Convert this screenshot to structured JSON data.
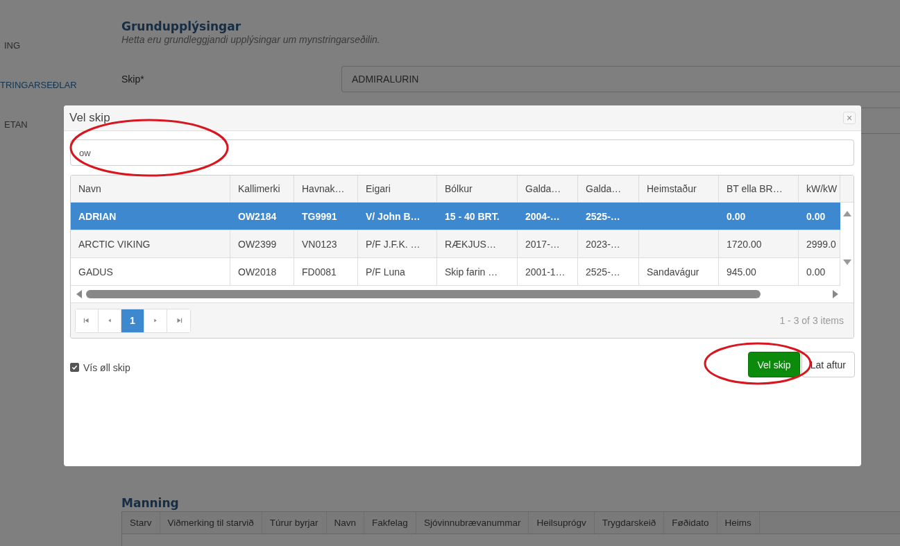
{
  "sidebar": {
    "items": [
      {
        "label": "ING",
        "selected": false
      },
      {
        "label": "TRINGARSEÐLAR",
        "selected": true
      },
      {
        "label": "ETAN",
        "selected": false
      }
    ]
  },
  "section": {
    "title": "Grundupplýsingar",
    "subtitle": "Hetta eru grundleggjandi upplýsingar um mynstringarseðilin.",
    "fields": [
      {
        "label": "Skip*",
        "value": "ADMIRALURIN"
      }
    ]
  },
  "manning": {
    "title": "Manning",
    "columns": [
      "Starv",
      "Viðmerking til starvið",
      "Túrur byrjar",
      "Navn",
      "Fakfelag",
      "Sjóvinnubrævanummar",
      "Heilsuprógv",
      "Trygdarskeið",
      "Føðidato",
      "Heims"
    ]
  },
  "dialog": {
    "title": "Vel skip",
    "close": "×",
    "search": {
      "value": "ow"
    },
    "table": {
      "columns": [
        "Navn",
        "Kallimerki",
        "Havnak…",
        "Eigari",
        "Bólkur",
        "Galda…",
        "Galda…",
        "Heimstaður",
        "BT ella BR…",
        "kW/kW"
      ],
      "rows": [
        {
          "selected": true,
          "cells": [
            "ADRIAN",
            "OW2184",
            "TG9991",
            "V/ John B…",
            "15 - 40 BRT.",
            "2004-…",
            "2525-…",
            "",
            "0.00",
            "0.00"
          ]
        },
        {
          "selected": false,
          "cells": [
            "ARCTIC VIKING",
            "OW2399",
            "VN0123",
            "P/F J.F.K. …",
            "RÆKJUS…",
            "2017-…",
            "2023-…",
            "",
            "1720.00",
            "2999.0"
          ]
        },
        {
          "selected": false,
          "cells": [
            "GADUS",
            "OW2018",
            "FD0081",
            "P/F Luna",
            "Skip farin …",
            "2001-1…",
            "2525-…",
            "Sandavágur",
            "945.00",
            "0.00"
          ]
        }
      ]
    },
    "pager": {
      "pages": [
        {
          "label": "1",
          "selected": true
        }
      ],
      "summary": "1 - 3 of 3 items"
    },
    "show_all": {
      "label": "Vís øll skip",
      "checked": true
    },
    "buttons": [
      {
        "label": "Vel skip",
        "kind": "primary"
      },
      {
        "label": "Lat aftur",
        "kind": "default"
      }
    ]
  }
}
